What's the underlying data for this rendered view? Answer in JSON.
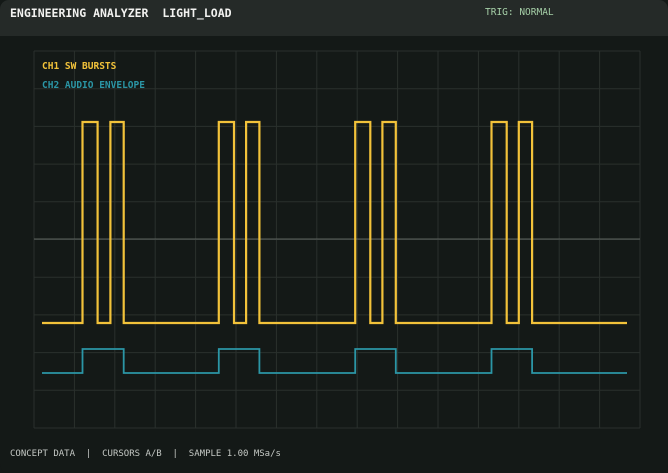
{
  "header": {
    "title": "ENGINEERING ANALYZER  LIGHT_LOAD",
    "trigger": "TRIG: NORMAL"
  },
  "footer": {
    "status": "CONCEPT DATA  |  CURSORS A/B  |  SAMPLE 1.00 MSa/s"
  },
  "colors": {
    "background": "#141917",
    "header": "#252a28",
    "grid": "#2a302d",
    "center_line": "#5c625e",
    "ch1": "#f2c23a",
    "ch2": "#2b96a6"
  },
  "chart_data": {
    "type": "line",
    "grid": true,
    "grid_divisions": {
      "x": 15,
      "y": 10
    },
    "series": [
      {
        "name": "CH1 SW BURSTS",
        "color": "#f2c23a",
        "low": 0,
        "high": 1,
        "baseline": "low",
        "pulses": [
          [
            0.08,
            0.105
          ],
          [
            0.126,
            0.148
          ],
          [
            0.305,
            0.33
          ],
          [
            0.35,
            0.372
          ],
          [
            0.53,
            0.555
          ],
          [
            0.575,
            0.597
          ],
          [
            0.755,
            0.78
          ],
          [
            0.8,
            0.822
          ]
        ]
      },
      {
        "name": "CH2 AUDIO ENVELOPE",
        "color": "#2b96a6",
        "low": 0,
        "high": 1,
        "baseline": "low",
        "pulses": [
          [
            0.08,
            0.148
          ],
          [
            0.305,
            0.372
          ],
          [
            0.53,
            0.597
          ],
          [
            0.755,
            0.822
          ]
        ]
      }
    ]
  }
}
